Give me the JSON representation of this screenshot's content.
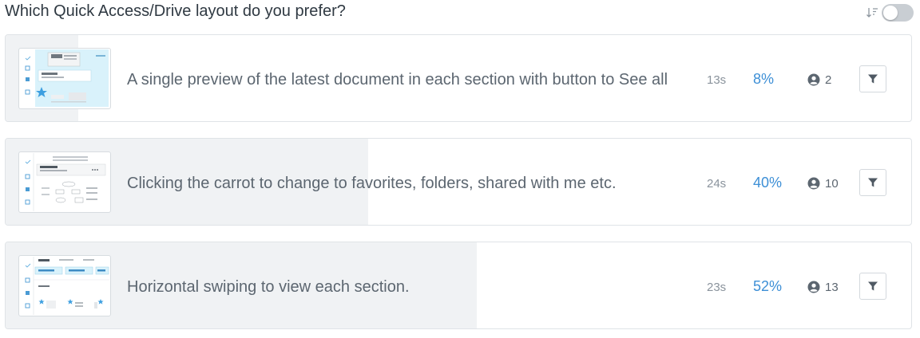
{
  "question": {
    "title": "Which Quick Access/Drive layout do you prefer?",
    "sort_icon": "sort-descending-icon",
    "toggle_on": false
  },
  "answers": [
    {
      "text": "A single preview of the latest document in each section with button to See all",
      "time": "13s",
      "percent_label": "8%",
      "percent": 8,
      "voters": "2",
      "icons": [
        "thumbnail-image",
        "user-icon",
        "filter-icon"
      ]
    },
    {
      "text": "Clicking the carrot to change to favorites, folders, shared with me etc.",
      "time": "24s",
      "percent_label": "40%",
      "percent": 40,
      "voters": "10",
      "icons": [
        "thumbnail-image",
        "user-icon",
        "filter-icon"
      ]
    },
    {
      "text": "Horizontal swiping to view each section.",
      "time": "23s",
      "percent_label": "52%",
      "percent": 52,
      "voters": "13",
      "icons": [
        "thumbnail-image",
        "user-icon",
        "filter-icon"
      ]
    }
  ],
  "colors": {
    "percent": "#3d8fd6",
    "fill": "#f0f2f4",
    "border": "#dfe3e7",
    "thumbnail_accent": "#d9f2fb"
  }
}
